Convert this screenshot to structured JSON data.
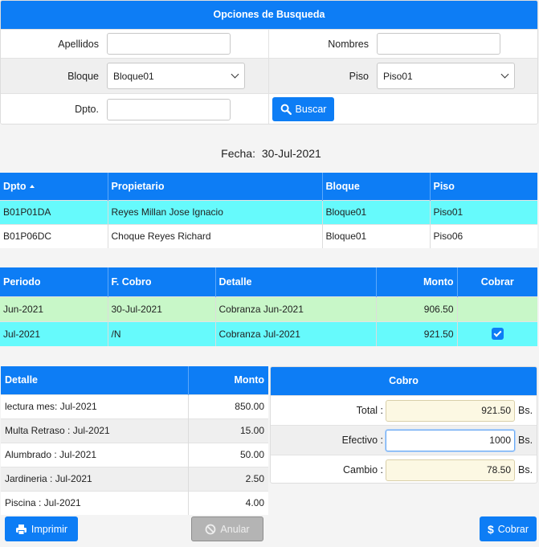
{
  "search": {
    "title": "Opciones de Busqueda",
    "apellidos_label": "Apellidos",
    "apellidos_value": "",
    "nombres_label": "Nombres",
    "nombres_value": "",
    "bloque_label": "Bloque",
    "bloque_value": "Bloque01",
    "piso_label": "Piso",
    "piso_value": "Piso01",
    "dpto_label": "Dpto.",
    "dpto_value": "",
    "buscar_label": "Buscar"
  },
  "fecha": {
    "label": "Fecha:",
    "value": "30-Jul-2021"
  },
  "departamentos": {
    "headers": [
      "Dpto",
      "Propietario",
      "Bloque",
      "Piso"
    ],
    "rows": [
      [
        "B01P01DA",
        "Reyes Millan Jose Ignacio",
        "Bloque01",
        "Piso01"
      ],
      [
        "B01P06DC",
        "Choque Reyes Richard",
        "Bloque01",
        "Piso06"
      ]
    ]
  },
  "periodos": {
    "headers": [
      "Periodo",
      "F. Cobro",
      "Detalle",
      "Monto",
      "Cobrar"
    ],
    "rows": [
      [
        "Jun-2021",
        "30-Jul-2021",
        "Cobranza Jun-2021",
        "906.50"
      ],
      [
        "Jul-2021",
        "/N",
        "Cobranza Jul-2021",
        "921.50"
      ]
    ],
    "cobrar_checked": [
      false,
      true
    ]
  },
  "detalle": {
    "headers": [
      "Detalle",
      "Monto"
    ],
    "rows": [
      [
        "lectura mes: Jul-2021",
        "850.00"
      ],
      [
        "Multa Retraso : Jul-2021",
        "15.00"
      ],
      [
        "Alumbrado : Jul-2021",
        "50.00"
      ],
      [
        "Jardineria : Jul-2021",
        "2.50"
      ],
      [
        "Piscina : Jul-2021",
        "4.00"
      ]
    ]
  },
  "cobro": {
    "title": "Cobro",
    "total_label": "Total :",
    "total_value": "921.50",
    "efectivo_label": "Efectivo :",
    "efectivo_value": "1000",
    "cambio_label": "Cambio :",
    "cambio_value": "78.50",
    "unit": "Bs."
  },
  "actions": {
    "imprimir": "Imprimir",
    "anular": "Anular",
    "cobrar": "Cobrar"
  },
  "colors": {
    "primary": "#0d7df5",
    "row_selected": "#66fafc",
    "row_paid": "#c8f7c8",
    "readonly_input": "#fcf8e3"
  }
}
